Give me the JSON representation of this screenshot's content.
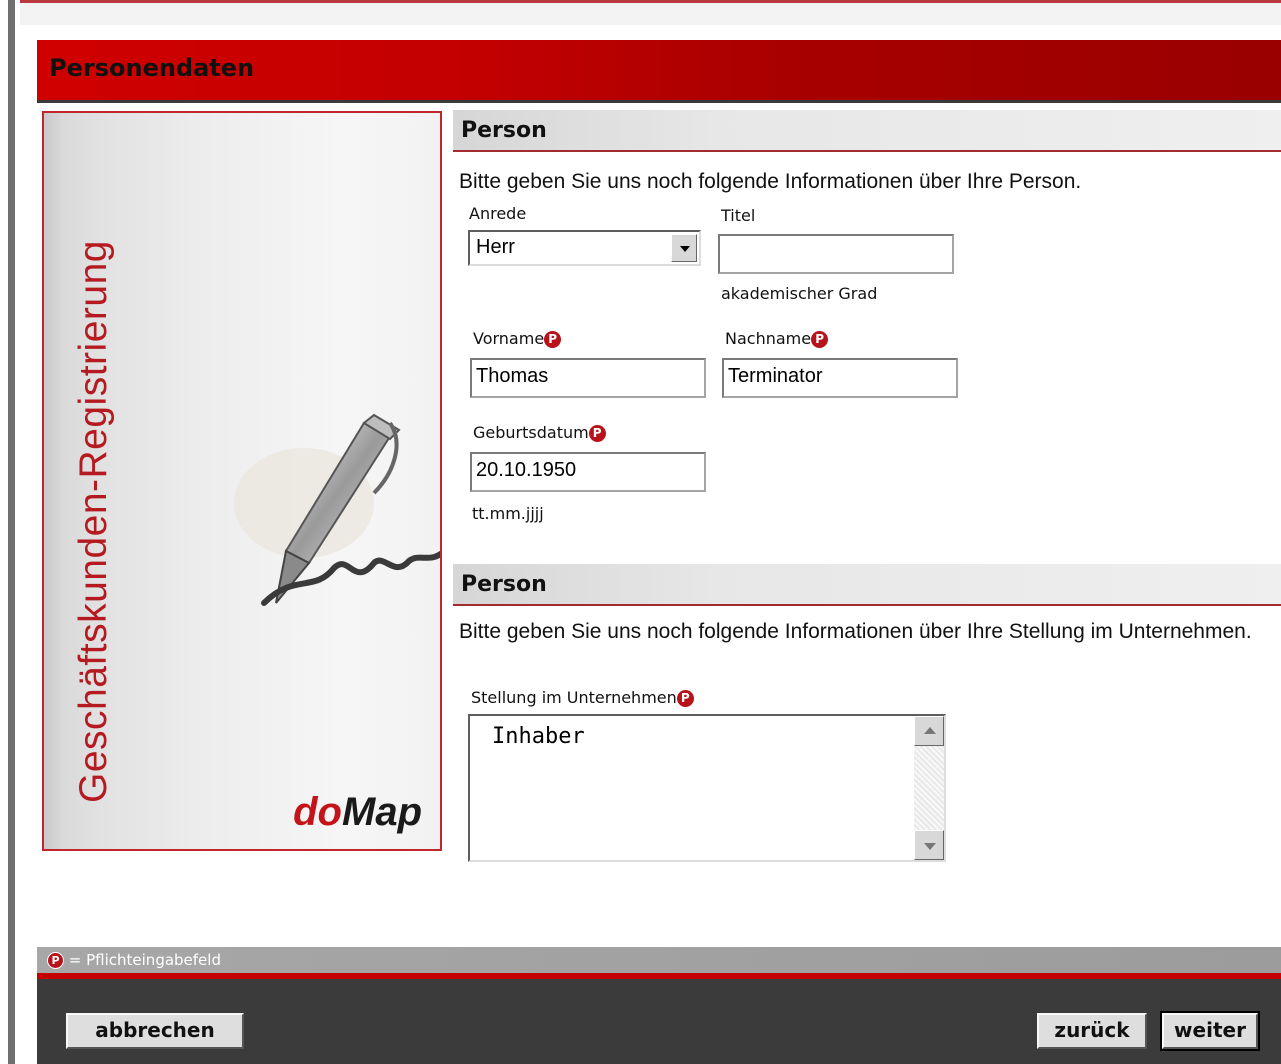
{
  "header": {
    "title": "Personendaten"
  },
  "side": {
    "vertical_text": "Geschäftskunden-Registrierung",
    "logo_do": "do",
    "logo_map": "Map"
  },
  "section1": {
    "title": "Person",
    "intro": "Bitte geben Sie uns noch folgende Informationen über Ihre Person.",
    "anrede": {
      "label": "Anrede",
      "value": "Herr"
    },
    "titel": {
      "label": "Titel",
      "value": "",
      "hint": "akademischer Grad"
    },
    "vorname": {
      "label": "Vorname",
      "value": "Thomas"
    },
    "nachname": {
      "label": "Nachname",
      "value": "Terminator"
    },
    "geburtsdatum": {
      "label": "Geburtsdatum",
      "value": "20.10.1950",
      "hint": "tt.mm.jjjj"
    }
  },
  "section2": {
    "title": "Person",
    "intro": "Bitte geben Sie uns noch folgende Informationen über Ihre Stellung im Unternehmen.",
    "stellung": {
      "label": "Stellung im Unternehmen",
      "value": "Inhaber"
    }
  },
  "required_mark": "P",
  "legend": {
    "text": "= Pflichteingabefeld"
  },
  "buttons": {
    "cancel": "abbrechen",
    "back": "zurück",
    "next": "weiter"
  },
  "colors": {
    "brand_red": "#c40000",
    "dark_footer": "#3b3b3b"
  }
}
